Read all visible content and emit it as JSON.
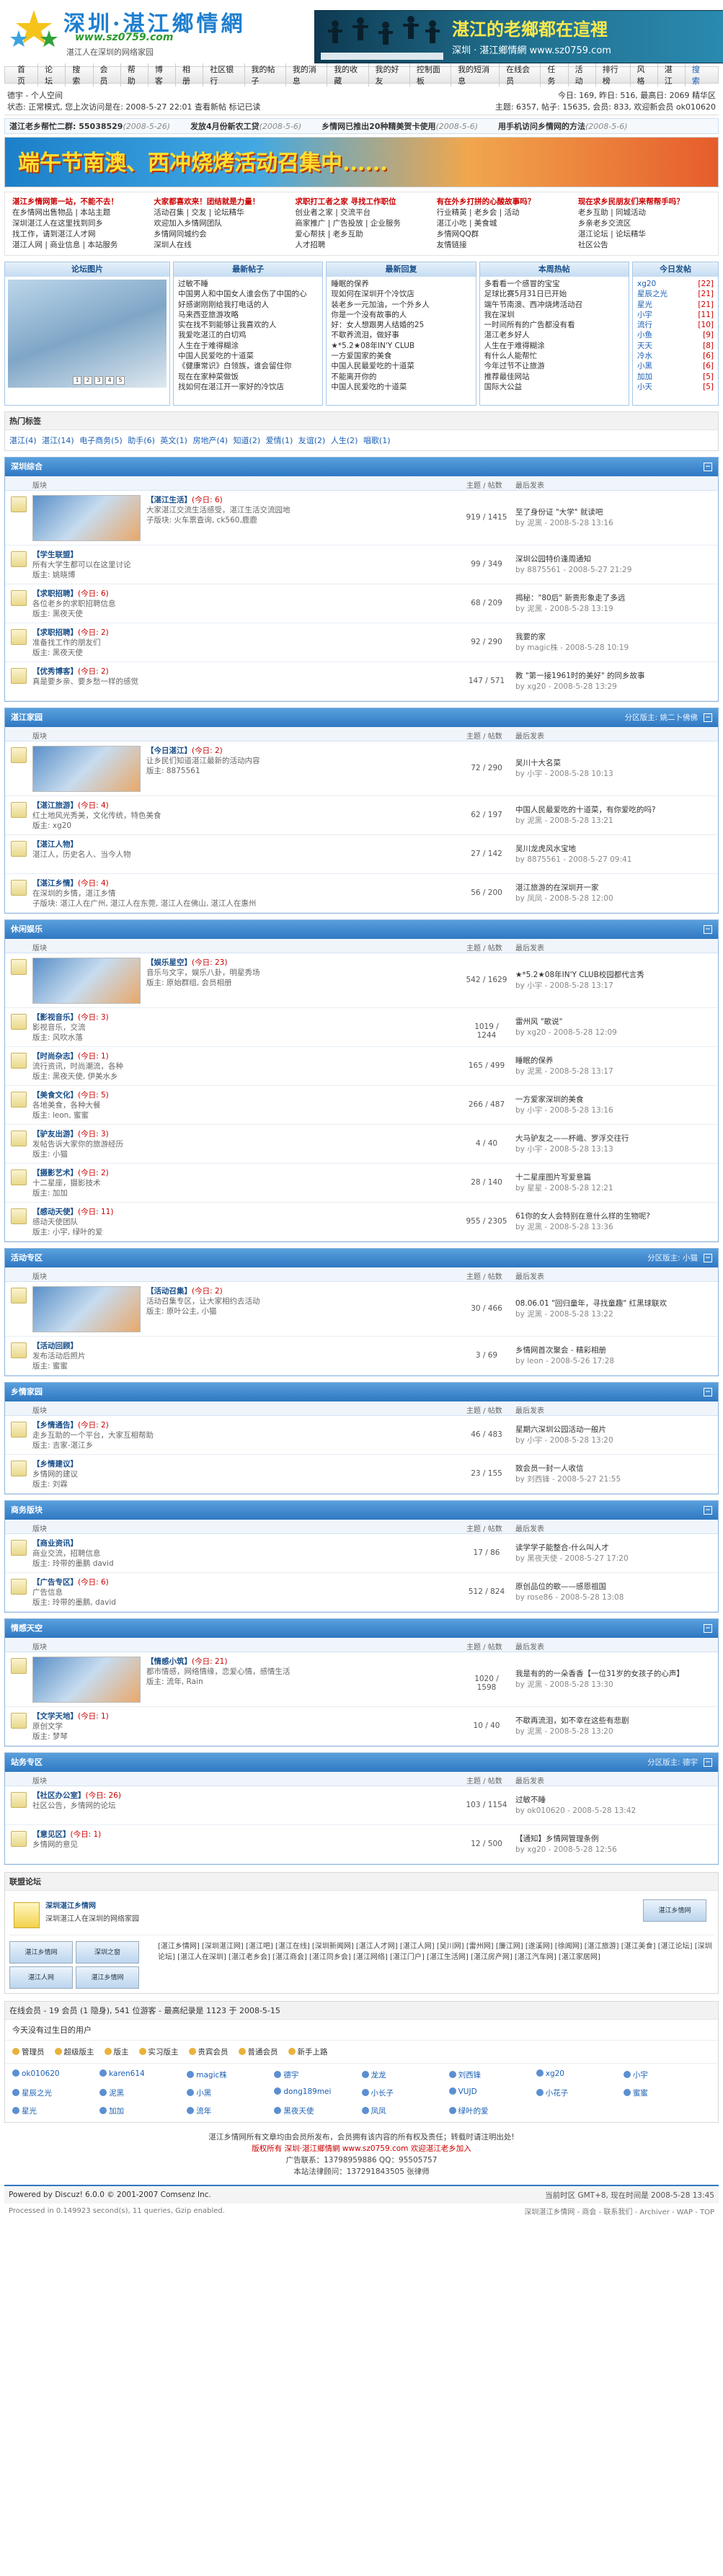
{
  "header": {
    "logo_title": "深圳·湛江鄉情網",
    "logo_url": "www.sz0759.com",
    "logo_slogan": "湛江人在深圳的网络家园",
    "banner_title": "湛江的老鄉都在這裡",
    "banner_sub": "深圳 · 湛江鄉情網 www.sz0759.com"
  },
  "nav": [
    "首页",
    "论坛",
    "搜索",
    "会员",
    "帮助",
    "博客",
    "相册",
    "社区银行",
    "我的帖子",
    "我的消息",
    "我的收藏",
    "我的好友",
    "控制面板",
    "我的短消息",
    "在线会员",
    "任务",
    "活动",
    "排行榜",
    "风格",
    "湛江"
  ],
  "nav_search": "搜索",
  "user": {
    "line1": "德宇 - 个人空间",
    "line2": "状态: 正常模式, 您上次访问是在: 2008-5-27 22:01 查看新帖 标记已读",
    "right1": "今日: 169, 昨日: 516, 最高日: 2069  精华区",
    "right2": "主题: 6357, 帖子: 15635, 会员: 833, 欢迎新会员 ok010620"
  },
  "ticker": [
    {
      "t": "湛江老乡帮忙二群: 55038529",
      "d": "(2008-5-26)"
    },
    {
      "t": "发放4月份新农工贷",
      "d": "(2008-5-6)"
    },
    {
      "t": "乡情网已推出20种精美贺卡使用",
      "d": "(2008-5-6)"
    },
    {
      "t": "用手机访问乡情网的方法",
      "d": "(2008-5-6)"
    }
  ],
  "promo": "端午节南澳、西冲烧烤活动召集中......",
  "ads": [
    [
      "湛江乡情网第一站，不能不去！",
      "在乡情网出售物品 | 本站主题",
      "深圳湛江人在这里找到同乡",
      "找工作，请到湛江人才网",
      "湛江人网 | 商业信息 | 本站服务"
    ],
    [
      "大家都喜欢来！团结就是力量！",
      "活动召集 | 交友 | 论坛精华",
      "欢迎加入乡情网团队",
      "乡情网同城约会",
      "深圳人在线"
    ],
    [
      "求职打工者之家 寻找工作职位",
      "创业者之家 | 交流平台",
      "商家推广 | 广告投放 | 企业服务",
      "爱心帮扶 | 老乡互助",
      "人才招聘"
    ],
    [
      "有在外乡打拼的心酸故事吗？",
      "行业精英 | 老乡会 | 活动",
      "湛江小吃 | 美食城",
      "乡情网QQ群",
      "友情链接"
    ],
    [
      "现在求乡民朋友们来帮帮手吗？",
      "老乡互助 | 同城活动",
      "乡亲老乡交流区",
      "湛江论坛 | 论坛精华",
      "社区公告"
    ]
  ],
  "portal": {
    "pic_head": "论坛图片",
    "new_head": "最新帖子",
    "hot_head": "最新回复",
    "week_head": "本周热帖",
    "rank_head": "今日发帖",
    "pager": [
      "1",
      "2",
      "3",
      "4",
      "5"
    ],
    "new": [
      "过敏不睡",
      "中国男人和中国女人谁会伤了中国的心",
      "好感谢刚刚给我打电话的人",
      "马来西亚旅游攻略",
      "实在找不到能够让我喜欢的人",
      "我爱吃湛江的白切鸡",
      "人生在于难得糊涂",
      "中国人民爱吃的十道菜",
      "《健康常识》白领族，谁会留住你",
      "现在在家种菜做饭",
      "找如何在湛江开一家好的冷饮店"
    ],
    "hot": [
      "睡眠的保养",
      "现如何在深圳开个冷饮店",
      "装老乡一元加油，一个外乡人",
      "你是一个没有故事的人",
      "好：女人想跟男人结婚的25",
      "不歇养流泪，做好事",
      "★*5.2★08年IN'Y CLUB",
      "一方爱国家的美食",
      "中国人民最爱吃的十道菜",
      "不能离开你的",
      "中国人民爱吃的十道菜"
    ],
    "week": [
      "多看看一个感冒的宝宝",
      "足球比赛5月31日已开始",
      "端午节南澳、西冲烧烤活动召",
      "我在深圳",
      "一时间所有的广告都没有看",
      "湛江老乡好人",
      "人生在于难得糊涂",
      "有什么人能帮忙",
      "今年过节不让旅游",
      "推荐最佳网站",
      "国际大公益"
    ],
    "rank": [
      [
        "xg20",
        "[22]"
      ],
      [
        "星辰之光",
        "[21]"
      ],
      [
        "星光",
        "[21]"
      ],
      [
        "小宇",
        "[11]"
      ],
      [
        "流行",
        "[10]"
      ],
      [
        "小鱼",
        "[9]"
      ],
      [
        "天天",
        "[8]"
      ],
      [
        "冷水",
        "[6]"
      ],
      [
        "小黑",
        "[6]"
      ],
      [
        "加加",
        "[5]"
      ],
      [
        "小天",
        "[5]"
      ]
    ]
  },
  "hot_tags": {
    "title": "热门标签",
    "tags": [
      "湛江(4)",
      "湛江(14)",
      "电子商务(5)",
      "助手(6)",
      "英文(1)",
      "房地产(4)",
      "知道(2)",
      "爱情(1)",
      "友谊(2)",
      "人生(2)",
      "唱歌(1)"
    ]
  },
  "cols": {
    "forum": "版块",
    "topics": "主题 / 帖数",
    "last": "最后发表"
  },
  "sections": [
    {
      "title": "深圳综合",
      "mod": "",
      "forums": [
        {
          "name": "【湛江生活】",
          "today": "(今日: 6)",
          "desc": "大家湛江交流生活感受，湛江生活交流园地",
          "sub": "子版块: 火车票查询, ck560,鹿鹿",
          "count": "919 / 1415",
          "last": "至了身份证 \"大学\" 就读吧",
          "by": "by 泥黑 - 2008-5-28 13:16",
          "thumb": true
        },
        {
          "name": "【学生联盟】",
          "today": "",
          "desc": "所有大学生都可以在这里讨论",
          "sub": "版主: 姚晓博",
          "count": "99 / 349",
          "last": "深圳公园特价逢周通知",
          "by": "by 8875561 - 2008-5-27 21:29"
        },
        {
          "name": "【求职招聘】",
          "today": "(今日: 6)",
          "desc": "各位老乡的求职招聘信息",
          "sub": "版主: 黑夜天使",
          "count": "68 / 209",
          "last": "揭秘：\"80后\" 新贵形象走了多远",
          "by": "by 泥黑 - 2008-5-28 13:19"
        },
        {
          "name": "【求职招聘】",
          "today": "(今日: 2)",
          "desc": "准备找工作的朋友们",
          "sub": "版主: 黑夜天使",
          "count": "92 / 290",
          "last": "我要的家",
          "by": "by magic株 - 2008-5-28 10:19"
        },
        {
          "name": "【优秀博客】",
          "today": "(今日: 2)",
          "desc": "真是要乡亲、要乡愁一样的感觉",
          "sub": "",
          "count": "147 / 571",
          "last": "教 \"第一接1961时的美好\" 的同乡故事",
          "by": "by xg20 - 2008-5-28 13:29"
        }
      ]
    },
    {
      "title": "湛江家园",
      "mod": "分区版主: 姚二卜佛佛",
      "forums": [
        {
          "name": "【今日湛江】",
          "today": "(今日: 2)",
          "desc": "让乡民们知道湛江最新的活动内容",
          "sub": "版主: 8875561",
          "count": "72 / 290",
          "last": "吴川十大名菜",
          "by": "by 小宇 - 2008-5-28 10:13",
          "thumb": true
        },
        {
          "name": "【湛江旅游】",
          "today": "(今日: 4)",
          "desc": "红土地风光秀美，文化传统，特色美食",
          "sub": "版主: xg20",
          "count": "62 / 197",
          "last": "中国人民最爱吃的十道菜，有你爱吃的吗?",
          "by": "by 泥黑 - 2008-5-28 13:21"
        },
        {
          "name": "【湛江人物】",
          "today": "",
          "desc": "湛江人，历史名人、当今人物",
          "sub": "",
          "count": "27 / 142",
          "last": "吴川龙虎风水宝地",
          "by": "by 8875561 - 2008-5-27 09:41"
        },
        {
          "name": "【湛江乡情】",
          "today": "(今日: 4)",
          "desc": "在深圳的乡情，湛江乡情",
          "sub": "子版块: 湛江人在广州, 湛江人在东莞, 湛江人在佛山, 湛江人在惠州",
          "count": "56 / 200",
          "last": "湛江旅游的在深圳开一家",
          "by": "by 凤凤 - 2008-5-28 12:00"
        }
      ]
    },
    {
      "title": "休闲娱乐",
      "mod": "",
      "forums": [
        {
          "name": "【娱乐星空】",
          "today": "(今日: 23)",
          "desc": "音乐与文字，娱乐八卦，明星秀场",
          "sub": "版主: 原始群组, 会员相册",
          "count": "542 / 1629",
          "last": "★*5.2★08年IN'Y CLUB校园都代言秀",
          "by": "by 小宇 - 2008-5-28 13:17",
          "thumb": true
        },
        {
          "name": "【影视音乐】",
          "today": "(今日: 3)",
          "desc": "影视音乐，交流",
          "sub": "版主: 风吹水落",
          "count": "1019 / 1244",
          "last": "雷州风 \"歌说\"",
          "by": "by xg20 - 2008-5-28 12:09"
        },
        {
          "name": "【时尚杂志】",
          "today": "(今日: 1)",
          "desc": "流行资讯，时尚潮流，各种",
          "sub": "版主: 黑夜天使, 伊美水乡",
          "count": "165 / 499",
          "last": "睡眠的保养",
          "by": "by 泥黑 - 2008-5-28 13:17"
        },
        {
          "name": "【美食文化】",
          "today": "(今日: 5)",
          "desc": "各地美食，各种大餐",
          "sub": "版主: leon, 蜜蜜",
          "count": "266 / 487",
          "last": "一方爱家深圳的美食",
          "by": "by 小宇 - 2008-5-28 13:16"
        },
        {
          "name": "【驴友出游】",
          "today": "(今日: 3)",
          "desc": "发帖告诉大家你的旅游经历",
          "sub": "版主: 小猫",
          "count": "4 / 40",
          "last": "大马驴友之——杯峨、罗浮交往行",
          "by": "by 小宇 - 2008-5-28 13:13"
        },
        {
          "name": "【摄影艺术】",
          "today": "(今日: 2)",
          "desc": "十二星座，摄影技术",
          "sub": "版主: 加加",
          "count": "28 / 140",
          "last": "十二星座图片写爱意篇",
          "by": "by 星星 - 2008-5-28 12:21"
        },
        {
          "name": "【感动天使】",
          "today": "(今日: 11)",
          "desc": "感动天使团队",
          "sub": "版主: 小宇, 绿叶的爱",
          "count": "955 / 2305",
          "last": "61你的女人会特别在意什么样的生物呢?",
          "by": "by 泥黑 - 2008-5-28 13:36"
        }
      ]
    },
    {
      "title": "活动专区",
      "mod": "分区版主: 小猫",
      "forums": [
        {
          "name": "【活动召集】",
          "today": "(今日: 2)",
          "desc": "活动召集专区，让大家相约去活动",
          "sub": "版主: 原叶公主, 小猫",
          "count": "30 / 466",
          "last": "08.06.01 \"回归童年，寻找童趣\" 红黑球联欢",
          "by": "by 泥黑 - 2008-5-28 13:22",
          "thumb": true
        },
        {
          "name": "【活动回顾】",
          "today": "",
          "desc": "发布活动后照片",
          "sub": "版主: 蜜蜜",
          "count": "3 / 69",
          "last": "乡情网首次聚会 - 精彩相册",
          "by": "by leon - 2008-5-26 17:28"
        }
      ]
    },
    {
      "title": "乡情家园",
      "mod": "",
      "forums": [
        {
          "name": "【乡情通告】",
          "today": "(今日: 2)",
          "desc": "走乡互助的一个平台，大家互相帮助",
          "sub": "版主: 吉家-湛江乡",
          "count": "46 / 483",
          "last": "星期六深圳公园活动一般片",
          "by": "by 小宇 - 2008-5-28 13:20"
        },
        {
          "name": "【乡情建议】",
          "today": "",
          "desc": "乡情网的建议",
          "sub": "版主: 刘霖",
          "count": "23 / 155",
          "last": "致会员一封一人收信",
          "by": "by 刘西锋 - 2008-5-27 21:55"
        }
      ]
    },
    {
      "title": "商务版块",
      "mod": "",
      "forums": [
        {
          "name": "【商业资讯】",
          "today": "",
          "desc": "商业交流，招聘信息",
          "sub": "版主: 玲带的墨鹏 david",
          "count": "17 / 86",
          "last": "读学学子能整合-什么叫人才",
          "by": "by 黑夜天使 - 2008-5-27 17:20"
        },
        {
          "name": "【广告专区】",
          "today": "(今日: 6)",
          "desc": "广告信息",
          "sub": "版主: 玲带的墨鹏, david",
          "count": "512 / 824",
          "last": "原创品位的歌——感恩祖国",
          "by": "by rose86 - 2008-5-28 13:08"
        }
      ]
    },
    {
      "title": "情感天空",
      "mod": "",
      "forums": [
        {
          "name": "【情感小筑】",
          "today": "(今日: 21)",
          "desc": "都市情感，网络情缘，恋爱心情，感情生活",
          "sub": "版主: 流年, Rain",
          "count": "1020 / 1598",
          "last": "我是有的的一朵香香【一位31岁的女孩子的心声】",
          "by": "by 泥黑 - 2008-5-28 13:30",
          "thumb": true
        },
        {
          "name": "【文学天地】",
          "today": "(今日: 1)",
          "desc": "原创文学",
          "sub": "版主: 梦琴",
          "count": "10 / 40",
          "last": "不歇再流泪，如不幸在这些有悲剧",
          "by": "by 泥黑 - 2008-5-28 13:20"
        }
      ]
    },
    {
      "title": "站务专区",
      "mod": "分区版主: 德宇",
      "forums": [
        {
          "name": "【社区办公室】",
          "today": "(今日: 26)",
          "desc": "社区公告，乡情网的论坛",
          "sub": "",
          "count": "103 / 1154",
          "last": "过敏不睡",
          "by": "by ok010620 - 2008-5-28 13:42"
        },
        {
          "name": "【意见区】",
          "today": "(今日: 1)",
          "desc": "乡情网的意见",
          "sub": "",
          "count": "12 / 500",
          "last": "【通知】乡情网管理条例",
          "by": "by xg20 - 2008-5-28 12:56"
        }
      ]
    }
  ],
  "links": {
    "title": "联盟论坛",
    "name": "深圳湛江乡情网",
    "desc": "深圳湛江人在深圳的网络家园",
    "text": "[湛江乡情网] [深圳湛江网] [湛江吧] [湛江在线] [深圳新闻网] [湛江人才网] [湛江人网] [吴川网] [雷州网] [廉江网] [遂溪网] [徐闻网] [湛江旅游] [湛江美食] [湛江论坛] [深圳论坛] [湛江人在深圳] [湛江老乡会] [湛江商会] [湛江同乡会] [湛江网络] [湛江门户] [湛江生活网] [湛江房产网] [湛江汽车网] [湛江家居网]",
    "badge1": "湛江乡情网",
    "badge2": "深圳之窗",
    "badge3": "湛江人网"
  },
  "online": {
    "title": "在线会员 - 19 会员 (1 隐身), 541 位游客 - 最高纪录是 1123 于 2008-5-15",
    "bd": "今天没有过生日的用户",
    "legend": [
      "管理员",
      "超级版主",
      "版主",
      "实习版主",
      "贵宾会员",
      "普通会员",
      "新手上路"
    ],
    "users": [
      "ok010620",
      "karen614",
      "magic株",
      "德宇",
      "龙龙",
      "刘西锋",
      "xg20",
      "小宇",
      "星辰之光",
      "泥黑",
      "小黑",
      "dong189mei",
      "小长子",
      "VUJD",
      "小花子",
      "蜜蜜",
      "星光",
      "加加",
      "流年",
      "黑夜天使",
      "凤凤",
      "绿叶的爱"
    ]
  },
  "footer": {
    "l1": "湛江乡情网所有文章均由会员所发布，会员拥有该内容的所有权及责任；转载时请注明出处!",
    "l2": "版权所有 深圳·湛江鄉情網 www.sz0759.com 欢迎湛江老乡加入",
    "l3": "广告联系：13798959886  QQ：95505757",
    "l4": "本站法律顾问：137291843505 张律师",
    "powered": "Powered by Discuz! 6.0.0 © 2001-2007 Comsenz Inc.",
    "processed": "Processed in 0.149923 second(s), 11 queries, Gzip enabled.",
    "time": "当前时区 GMT+8, 现在时间是 2008-5-28 13:45",
    "links_r": "深圳湛江乡情网 - 商会 - 联系我们 - Archiver - WAP - TOP"
  }
}
